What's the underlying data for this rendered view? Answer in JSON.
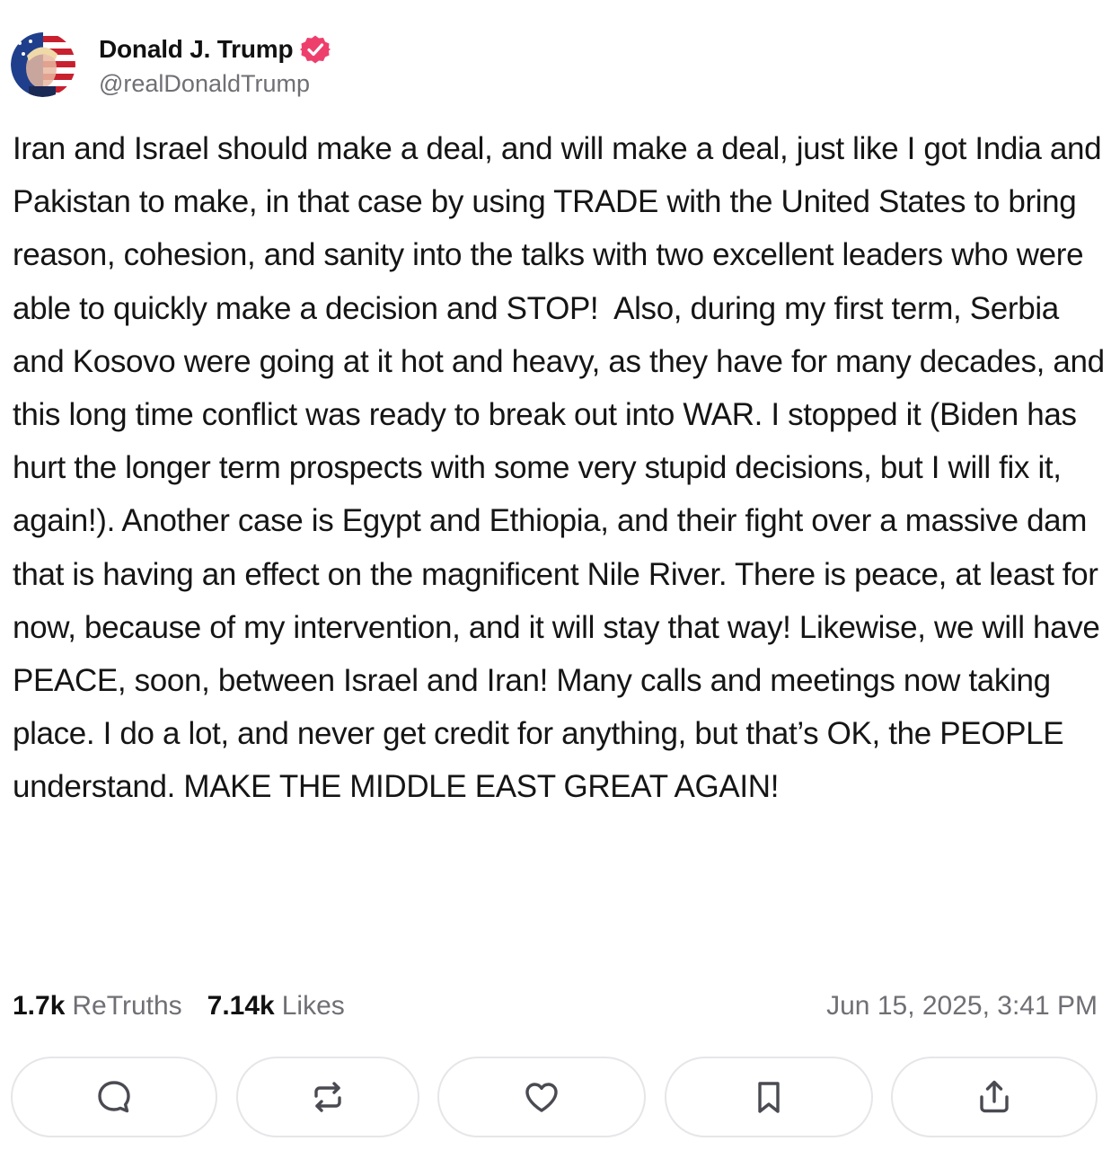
{
  "post": {
    "author": {
      "display_name": "Donald J. Trump",
      "handle": "@realDonaldTrump",
      "verified_icon": "verified-badge-icon",
      "verified_color": "#ee3f6c"
    },
    "body": "Iran and Israel should make a deal, and will make a deal, just like I got India and Pakistan to make, in that case by using TRADE with the United States to bring reason, cohesion, and sanity into the talks with two excellent leaders who were able to quickly make a decision and STOP!  Also, during my first term, Serbia and Kosovo were going at it hot and heavy, as they have for many decades, and this long time conflict was ready to break out into WAR. I stopped it (Biden has hurt the longer term prospects with some very stupid decisions, but I will fix it, again!). Another case is Egypt and Ethiopia, and their fight over a massive dam that is having an effect on the magnificent Nile River. There is peace, at least for now, because of my intervention, and it will stay that way! Likewise, we will have PEACE, soon, between Israel and Iran! Many calls and meetings now taking place. I do a lot, and never get credit for anything, but that’s OK, the PEOPLE understand. MAKE THE MIDDLE EAST GREAT AGAIN!",
    "stats": {
      "retruths_count": "1.7k",
      "retruths_label": "ReTruths",
      "likes_count": "7.14k",
      "likes_label": "Likes"
    },
    "timestamp": "Jun 15, 2025, 3:41 PM",
    "actions": [
      {
        "name": "reply-button",
        "icon": "comment-icon"
      },
      {
        "name": "retruth-button",
        "icon": "repost-icon"
      },
      {
        "name": "like-button",
        "icon": "heart-icon"
      },
      {
        "name": "bookmark-button",
        "icon": "bookmark-icon"
      },
      {
        "name": "share-button",
        "icon": "share-icon"
      }
    ]
  },
  "colors": {
    "text": "#151515",
    "muted": "#6f6f75",
    "border": "#e6e6e9",
    "icon": "#4a4a52"
  }
}
